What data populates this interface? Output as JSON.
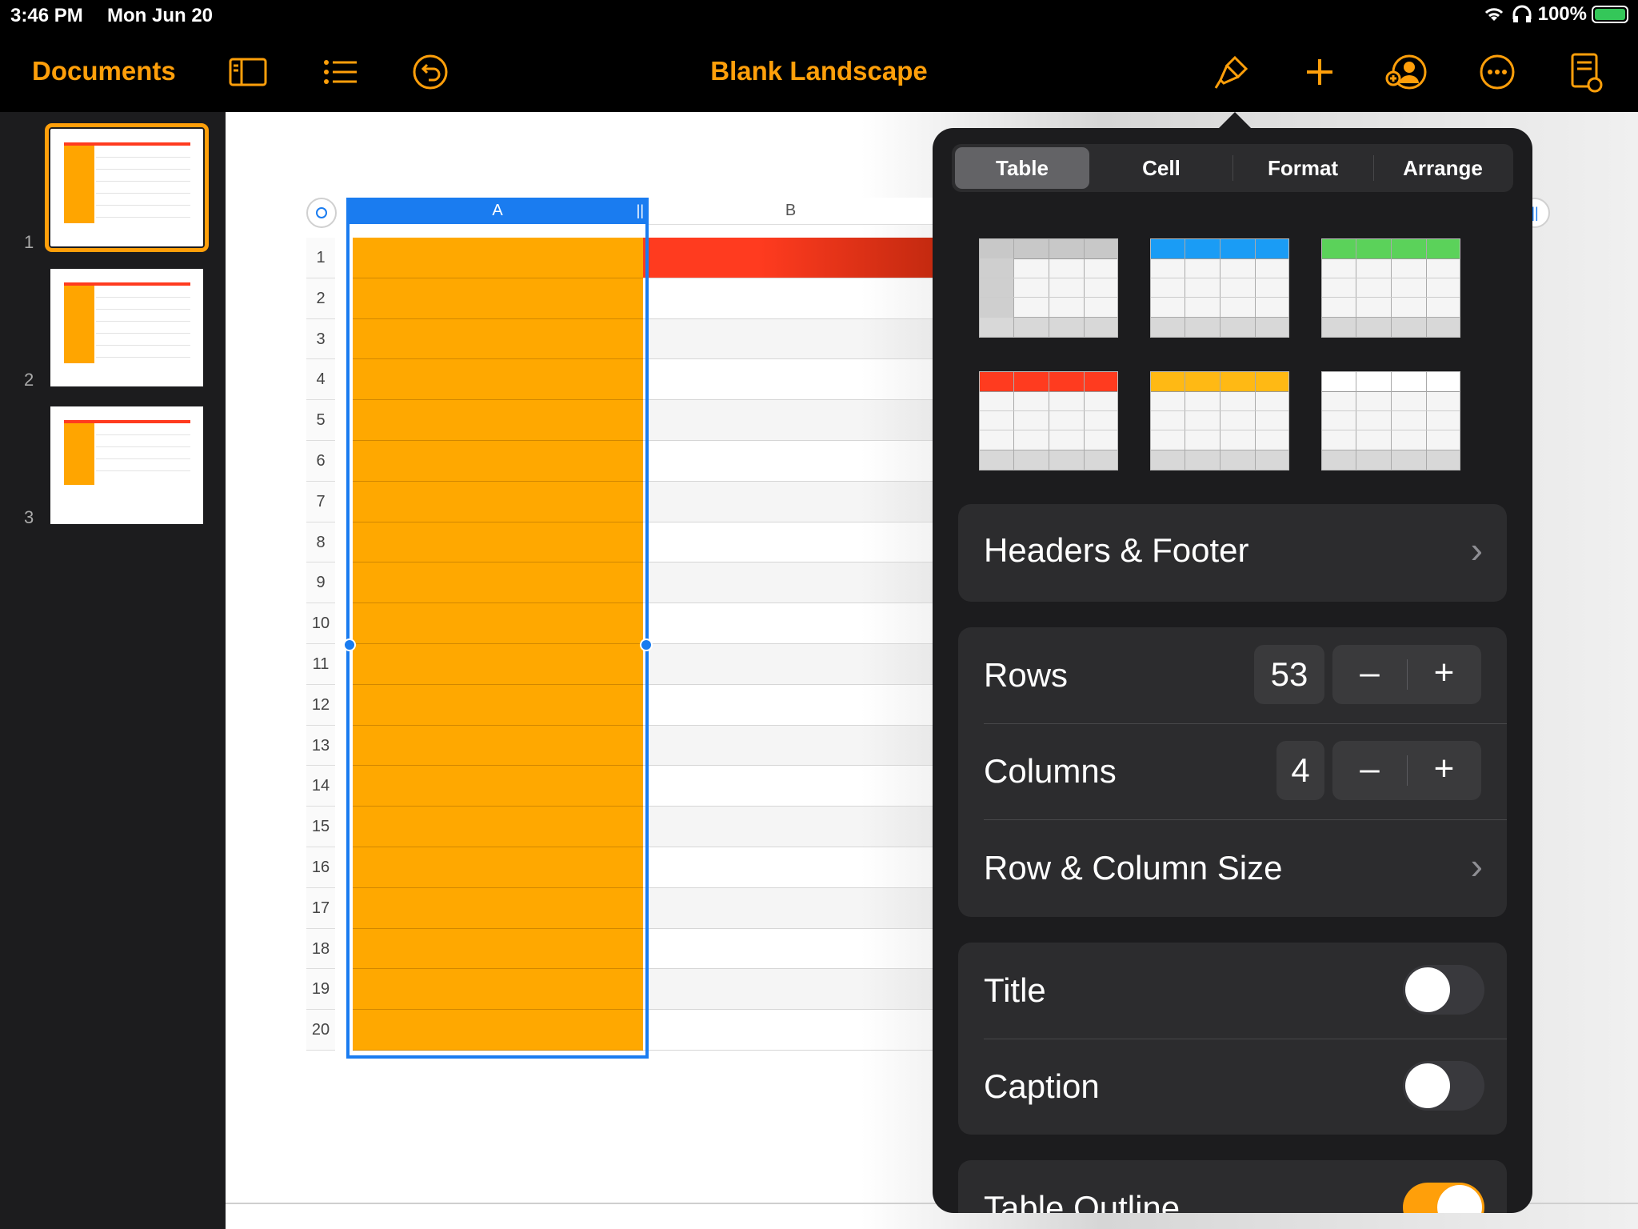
{
  "status": {
    "time": "3:46 PM",
    "date": "Mon Jun 20",
    "battery": "100%"
  },
  "toolbar": {
    "documents_label": "Documents",
    "doc_title": "Blank Landscape",
    "icons": [
      "sidebar-icon",
      "list-icon",
      "undo-icon",
      "paintbrush-icon",
      "plus-icon",
      "collaborate-icon",
      "more-icon",
      "document-options-icon"
    ]
  },
  "sidebar": {
    "slides": [
      {
        "number": "1",
        "selected": true
      },
      {
        "number": "2"
      },
      {
        "number": "3"
      }
    ]
  },
  "table": {
    "columns": [
      "A",
      "B"
    ],
    "rows": [
      "1",
      "2",
      "3",
      "4",
      "5",
      "6",
      "7",
      "8",
      "9",
      "10",
      "11",
      "12",
      "13",
      "14",
      "15",
      "16",
      "17",
      "18",
      "19",
      "20"
    ],
    "colors": {
      "header_column": "#ffa800",
      "header_row": "#ff3b1f",
      "selection": "#1a7cf0"
    }
  },
  "panel": {
    "tabs": [
      "Table",
      "Cell",
      "Format",
      "Arrange"
    ],
    "active_tab": "Table",
    "styles": [
      {
        "name": "gray",
        "accent": "#c8c8c8"
      },
      {
        "name": "blue",
        "accent": "#1a9cf5"
      },
      {
        "name": "green",
        "accent": "#5bd25a"
      },
      {
        "name": "red",
        "accent": "#ff3b1f"
      },
      {
        "name": "yellow",
        "accent": "#ffb914"
      },
      {
        "name": "plain",
        "accent": "#ffffff"
      }
    ],
    "headers_footer": "Headers & Footer",
    "rows_label": "Rows",
    "rows_value": "53",
    "columns_label": "Columns",
    "columns_value": "4",
    "minus": "–",
    "plus": "+",
    "row_col_size": "Row & Column Size",
    "title_label": "Title",
    "title_on": false,
    "caption_label": "Caption",
    "caption_on": false,
    "outline_label": "Table Outline",
    "outline_on": true,
    "chevron": "›"
  }
}
